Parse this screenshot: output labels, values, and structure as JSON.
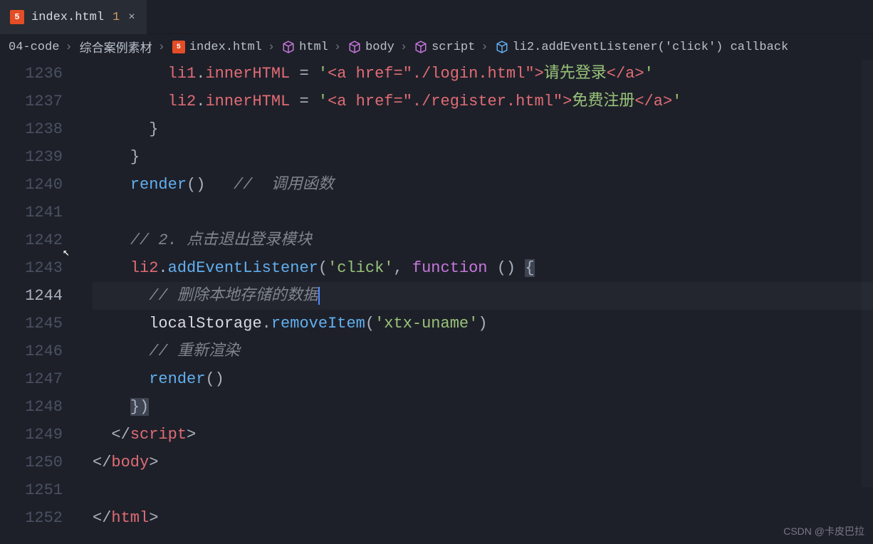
{
  "tab": {
    "filename": "index.html",
    "modified_indicator": "1",
    "close_label": "×"
  },
  "breadcrumbs": {
    "items": [
      {
        "label": "04-code",
        "icon": null
      },
      {
        "label": "综合案例素材",
        "icon": null
      },
      {
        "label": "index.html",
        "icon": "html5"
      },
      {
        "label": "html",
        "icon": "cube-purple"
      },
      {
        "label": "body",
        "icon": "cube-purple"
      },
      {
        "label": "script",
        "icon": "cube-purple"
      },
      {
        "label": "li2.addEventListener('click') callback",
        "icon": "cube-blue"
      }
    ]
  },
  "lines": {
    "start": 1236,
    "active": 1244,
    "numbers": [
      "1236",
      "1237",
      "1238",
      "1239",
      "1240",
      "1241",
      "1242",
      "1243",
      "1244",
      "1245",
      "1246",
      "1247",
      "1248",
      "1249",
      "1250",
      "1251",
      "1252"
    ]
  },
  "code": {
    "l1236": {
      "var1": "li1",
      "prop": "innerHTML",
      "eq": " = ",
      "s1": "'",
      "s2": "<a href=\"./login.html\">",
      "s3": "请先登录",
      "s4": "</a>",
      "s5": "'"
    },
    "l1237": {
      "var1": "li2",
      "prop": "innerHTML",
      "eq": " = ",
      "s1": "'",
      "s2": "<a href=\"./register.html\">",
      "s3": "免费注册",
      "s4": "</a>",
      "s5": "'"
    },
    "l1238": {
      "brace": "}"
    },
    "l1239": {
      "brace": "}"
    },
    "l1240": {
      "call": "render",
      "paren": "()",
      "sp": "   ",
      "comment": "//  调用函数"
    },
    "l1242": {
      "comment": "// 2. 点击退出登录模块"
    },
    "l1243": {
      "var": "li2",
      "dot": ".",
      "method": "addEventListener",
      "open": "(",
      "s": "'click'",
      "comma": ", ",
      "kw": "function",
      "sp": " ",
      "paren": "()",
      "sp2": " ",
      "brace": "{"
    },
    "l1244": {
      "comment": "// 删除本地存储的数据"
    },
    "l1245": {
      "obj": "localStorage",
      "dot": ".",
      "method": "removeItem",
      "open": "(",
      "s": "'xtx-uname'",
      "close": ")"
    },
    "l1246": {
      "comment": "// 重新渲染"
    },
    "l1247": {
      "call": "render",
      "paren": "()"
    },
    "l1248": {
      "close": "})"
    },
    "l1249": {
      "open": "</",
      "tag": "script",
      "close": ">"
    },
    "l1250": {
      "open": "</",
      "tag": "body",
      "close": ">"
    },
    "l1252": {
      "open": "</",
      "tag": "html",
      "close": ">"
    }
  },
  "watermark": "CSDN @卡皮巴拉"
}
